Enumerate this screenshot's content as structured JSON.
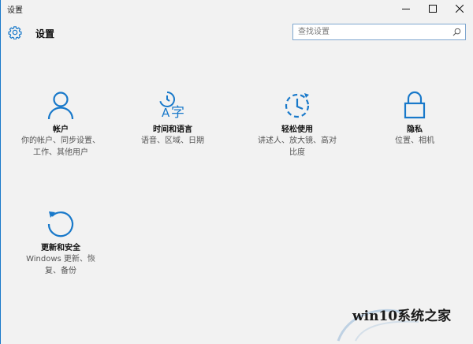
{
  "window": {
    "title": "设置"
  },
  "header": {
    "title": "设置",
    "search_placeholder": "查找设置"
  },
  "accent": "#1979ca",
  "tiles": [
    {
      "name": "帐户",
      "desc1": "你的帐户、同步设置、",
      "desc2": "工作、其他用户",
      "icon": "person-icon"
    },
    {
      "name": "时间和语言",
      "desc1": "语音、区域、日期",
      "desc2": "",
      "icon": "time-language-icon"
    },
    {
      "name": "轻松使用",
      "desc1": "讲述人、放大镜、高对",
      "desc2": "比度",
      "icon": "ease-of-access-icon"
    },
    {
      "name": "隐私",
      "desc1": "位置、相机",
      "desc2": "",
      "icon": "lock-icon"
    },
    {
      "name": "更新和安全",
      "desc1": "Windows 更新、恢",
      "desc2": "复、备份",
      "icon": "refresh-icon"
    }
  ],
  "watermark": {
    "text": "win10系统之家"
  }
}
